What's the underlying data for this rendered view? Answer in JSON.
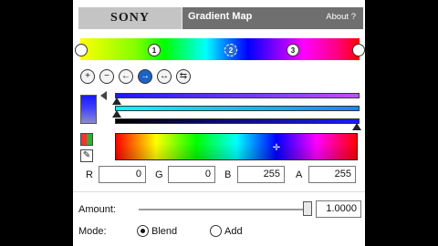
{
  "header": {
    "logo": "SONY",
    "title": "Gradient Map",
    "about": "About ?"
  },
  "gradient": {
    "stops": [
      "1",
      "2",
      "3"
    ],
    "selected_stop": "2"
  },
  "toolbar": {
    "icons": [
      "add-stop-icon",
      "remove-stop-icon",
      "move-left-icon",
      "move-right-icon",
      "spread-icon",
      "reverse-icon"
    ]
  },
  "color": {
    "r_label": "R",
    "r_value": "0",
    "g_label": "G",
    "g_value": "0",
    "b_label": "B",
    "b_value": "255",
    "a_label": "A",
    "a_value": "255"
  },
  "amount": {
    "label": "Amount:",
    "value": "1.0000",
    "slider_fraction": 1.0
  },
  "mode": {
    "label": "Mode:",
    "options": [
      "Blend",
      "Add"
    ],
    "selected": "Blend"
  },
  "colors": {
    "header_bg": "#6f6f6f",
    "selected_stop": "#2a6fd6",
    "panel_bg": "#ffffff"
  }
}
